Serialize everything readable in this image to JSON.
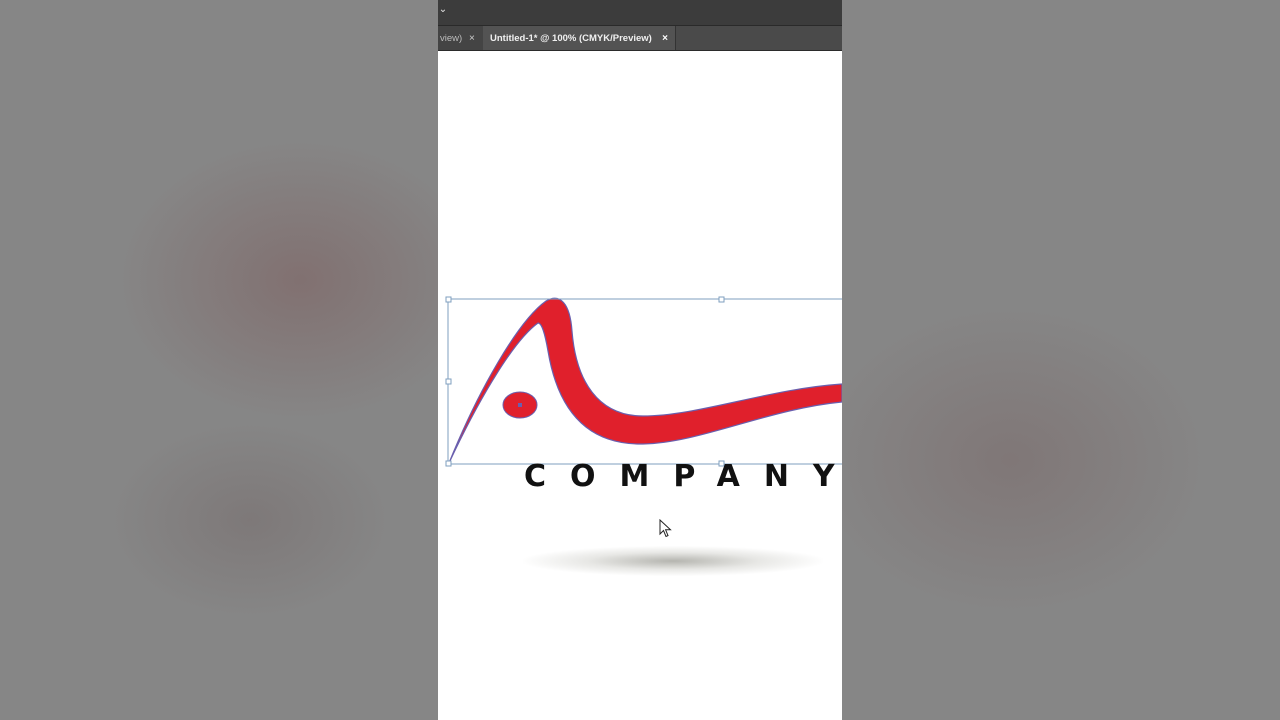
{
  "app": {
    "menu_icon": "chevron-down-icon",
    "tabs": [
      {
        "label": "view)",
        "close_glyph": "×",
        "active": false
      },
      {
        "label": "Untitled-1* @ 100% (CMYK/Preview)",
        "close_glyph": "×",
        "active": true
      }
    ]
  },
  "artwork": {
    "logo_text": "COMPANY",
    "colors": {
      "swoosh_fill": "#e0202c",
      "swoosh_outline": "#6a5fae",
      "selection": "#7f9fbf",
      "text": "#111111"
    }
  }
}
